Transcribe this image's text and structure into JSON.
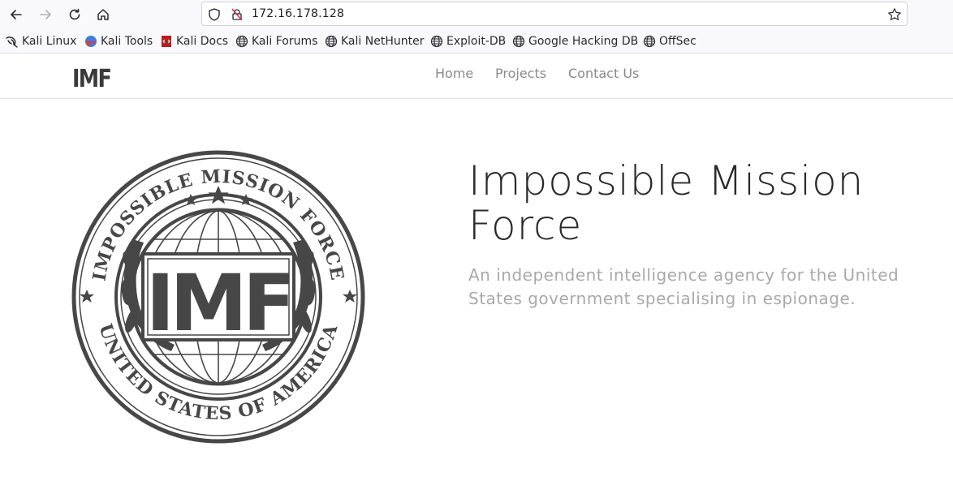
{
  "browser": {
    "url": "172.16.178.128",
    "icons": {
      "back": "back-arrow-icon",
      "forward": "forward-arrow-icon",
      "reload": "reload-icon",
      "home": "home-icon",
      "tracking": "shield-icon",
      "insecure": "insecure-lock-icon",
      "bookmark": "star-icon"
    },
    "bookmarks": [
      {
        "label": "Kali Linux",
        "icon": "kali-dragon-icon"
      },
      {
        "label": "Kali Tools",
        "icon": "kali-tools-icon"
      },
      {
        "label": "Kali Docs",
        "icon": "kali-docs-icon"
      },
      {
        "label": "Kali Forums",
        "icon": "globe-icon"
      },
      {
        "label": "Kali NetHunter",
        "icon": "globe-icon"
      },
      {
        "label": "Exploit-DB",
        "icon": "globe-icon"
      },
      {
        "label": "Google Hacking DB",
        "icon": "globe-icon"
      },
      {
        "label": "OffSec",
        "icon": "globe-icon"
      }
    ]
  },
  "site": {
    "brand": "IMF",
    "nav": [
      "Home",
      "Projects",
      "Contact Us"
    ],
    "hero": {
      "title": "Impossible Mission Force",
      "subtitle": "An independent intelligence agency for the United States government specialising in espionage."
    },
    "seal": {
      "top_text": "IMPOSSIBLE MISSION FORCE",
      "bottom_text": "UNITED STATES OF AMERICA",
      "center_text": "IMF"
    }
  },
  "colors": {
    "seal": "#474747",
    "nav_link": "#8a8a8a",
    "subtitle": "#a9a9a9"
  }
}
